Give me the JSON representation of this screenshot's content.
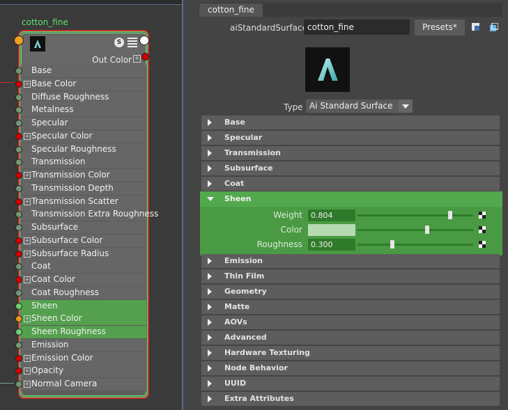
{
  "node_editor": {
    "node_title": "cotton_fine",
    "swatch_badge": "S",
    "output_label": "Out Color",
    "attributes": [
      {
        "label": "Base",
        "port": "grey",
        "expandable": false,
        "highlight": false
      },
      {
        "label": "Base Color",
        "port": "red",
        "expandable": true,
        "highlight": false
      },
      {
        "label": "Diffuse Roughness",
        "port": "grey",
        "expandable": false,
        "highlight": false
      },
      {
        "label": "Metalness",
        "port": "grey",
        "expandable": false,
        "highlight": false
      },
      {
        "label": "Specular",
        "port": "grey",
        "expandable": false,
        "highlight": false
      },
      {
        "label": "Specular Color",
        "port": "red",
        "expandable": true,
        "highlight": false
      },
      {
        "label": "Specular Roughness",
        "port": "grey",
        "expandable": false,
        "highlight": false
      },
      {
        "label": "Transmission",
        "port": "grey",
        "expandable": false,
        "highlight": false
      },
      {
        "label": "Transmission Color",
        "port": "red",
        "expandable": true,
        "highlight": false
      },
      {
        "label": "Transmission Depth",
        "port": "grey",
        "expandable": false,
        "highlight": false
      },
      {
        "label": "Transmission Scatter",
        "port": "red",
        "expandable": true,
        "highlight": false
      },
      {
        "label": "Transmission Extra Roughness",
        "port": "grey",
        "expandable": false,
        "highlight": false
      },
      {
        "label": "Subsurface",
        "port": "grey",
        "expandable": false,
        "highlight": false
      },
      {
        "label": "Subsurface Color",
        "port": "red",
        "expandable": true,
        "highlight": false
      },
      {
        "label": "Subsurface Radius",
        "port": "red",
        "expandable": true,
        "highlight": false
      },
      {
        "label": "Coat",
        "port": "grey",
        "expandable": false,
        "highlight": false
      },
      {
        "label": "Coat Color",
        "port": "red",
        "expandable": true,
        "highlight": false
      },
      {
        "label": "Coat Roughness",
        "port": "grey",
        "expandable": false,
        "highlight": false
      },
      {
        "label": "Sheen",
        "port": "green",
        "expandable": false,
        "highlight": true
      },
      {
        "label": "Sheen Color",
        "port": "orange",
        "expandable": true,
        "highlight": true
      },
      {
        "label": "Sheen Roughness",
        "port": "green",
        "expandable": false,
        "highlight": true
      },
      {
        "label": "Emission",
        "port": "grey",
        "expandable": false,
        "highlight": false
      },
      {
        "label": "Emission Color",
        "port": "red",
        "expandable": true,
        "highlight": false
      },
      {
        "label": "Opacity",
        "port": "red",
        "expandable": true,
        "highlight": false
      },
      {
        "label": "Normal Camera",
        "port": "grey",
        "expandable": true,
        "highlight": false
      }
    ]
  },
  "attribute_editor": {
    "tab_label": "cotton_fine",
    "node_type_label": "aiStandardSurface:",
    "node_name": "cotton_fine",
    "presets_label": "Presets*",
    "type_label": "Type",
    "type_value": "Ai Standard Surface",
    "sections_top": [
      "Base",
      "Specular",
      "Transmission",
      "Subsurface",
      "Coat"
    ],
    "sheen": {
      "title": "Sheen",
      "weight_label": "Weight",
      "weight_value": "0.804",
      "color_label": "Color",
      "roughness_label": "Roughness",
      "roughness_value": "0.300",
      "weight_slider": 0.804,
      "color_slider": 0.6,
      "roughness_slider": 0.3
    },
    "sections_bottom": [
      "Emission",
      "Thin Film",
      "Geometry",
      "Matte",
      "AOVs",
      "Advanced",
      "Hardware Texturing",
      "Node Behavior",
      "UUID",
      "Extra Attributes"
    ]
  },
  "colors": {
    "accent_green": "#5fe36c",
    "selection_red": "#d12a2a",
    "sheen_highlight": "#4a9a44"
  }
}
